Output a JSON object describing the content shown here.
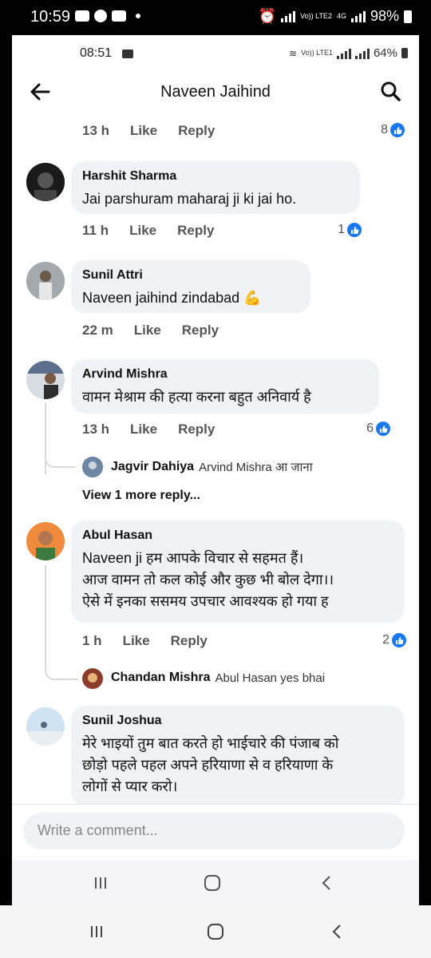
{
  "outer_status": {
    "time": "10:59",
    "battery": "98%",
    "lte_label": "Vo)) LTE2",
    "net": "4G"
  },
  "inner_status": {
    "time": "08:51",
    "battery": "64%",
    "lte_label": "Vo)) LTE1"
  },
  "header": {
    "title": "Naveen Jaihind",
    "back_icon": "arrow-left-icon",
    "search_icon": "search-icon"
  },
  "labels": {
    "like": "Like",
    "reply": "Reply"
  },
  "top_meta": {
    "time": "13 h",
    "reactions": "8"
  },
  "comments": [
    {
      "name": "Harshit Sharma",
      "text": "Jai parshuram maharaj ji ki jai ho.",
      "time": "11 h",
      "reactions": "1"
    },
    {
      "name": "Sunil Attri",
      "text": "Naveen jaihind zindabad 💪",
      "time": "22 m",
      "reactions": ""
    },
    {
      "name": "Arvind Mishra",
      "text": "वामन मेश्राम  की हत्या करना बहुत अनिवार्य है",
      "time": "13 h",
      "reactions": "6",
      "reply": {
        "name": "Jagvir Dahiya",
        "text": "Arvind Mishra आ जाना"
      },
      "view_more": "View 1 more reply..."
    },
    {
      "name": "Abul Hasan",
      "text_lines": [
        "Naveen ji हम आपके विचार से सहमत हैं।",
        "आज वामन तो कल कोई और कुछ भी बोल देगा।।",
        "ऐसे में इनका ससमय उपचार आवश्यक हो गया ह"
      ],
      "time": "1 h",
      "reactions": "2",
      "reply": {
        "name": "Chandan Mishra",
        "text": "Abul Hasan yes bhai"
      }
    },
    {
      "name": "Sunil Joshua",
      "text_lines": [
        "मेरे भाइयों तुम बात करते हो भाईचारे की पंजाब को",
        "छोड़ो पहले पहल अपने हरियाणा से व हरियाणा के",
        "लोगों से प्यार करो।"
      ]
    }
  ],
  "composer": {
    "placeholder": "Write a comment..."
  },
  "colors": {
    "accent": "#1877f2",
    "bubble": "#f0f2f5"
  }
}
